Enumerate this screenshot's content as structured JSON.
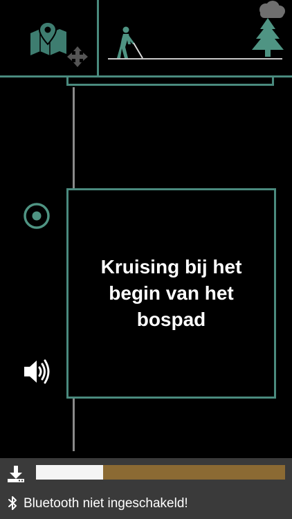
{
  "waypoint": {
    "description": "Kruising bij het begin van het bospad"
  },
  "download": {
    "progress": 0.27
  },
  "status": {
    "bluetooth_message": "Bluetooth niet ingeschakeld!"
  },
  "colors": {
    "accent": "#4a8a7e",
    "progress_fill": "#f4f4f4",
    "progress_track": "#8b6a33",
    "bottom_bar": "#3a3a3a"
  },
  "icons": {
    "map": "map-pin-icon",
    "move": "move-arrows-icon",
    "walker": "blind-walker-icon",
    "tree": "pine-tree-icon",
    "cloud": "cloud-icon",
    "locate": "locate-icon",
    "speaker": "speaker-icon",
    "download": "download-icon",
    "bluetooth": "bluetooth-icon"
  }
}
